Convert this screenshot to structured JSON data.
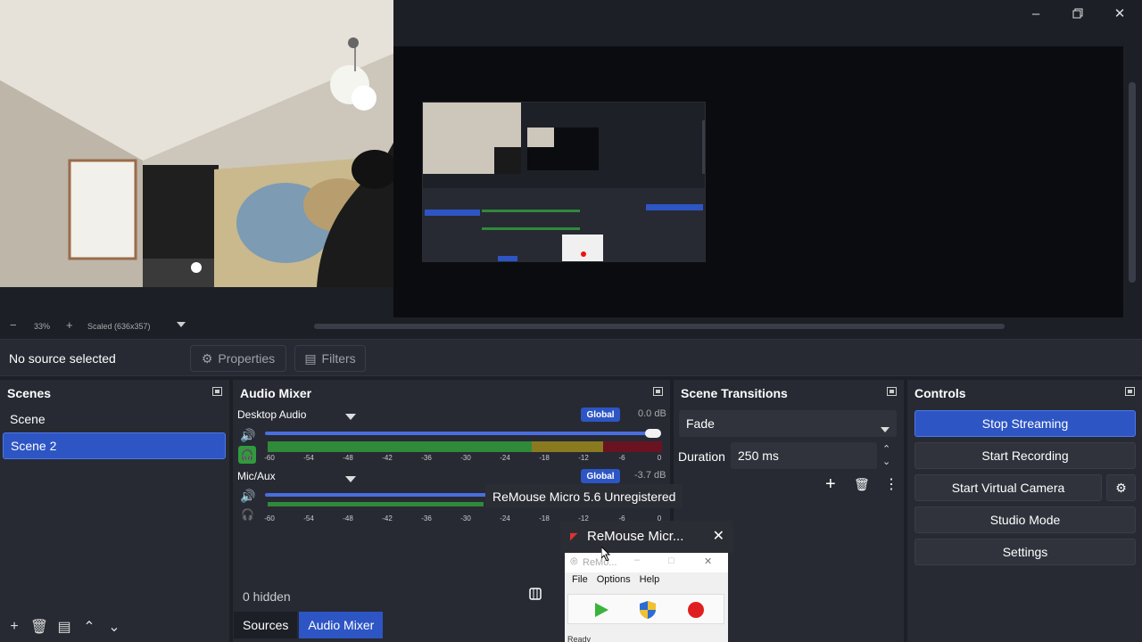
{
  "zoom": {
    "minus": "−",
    "level": "33%",
    "plus": "+",
    "scale": "Scaled (636x357)"
  },
  "context": {
    "no_source": "No source selected",
    "properties": "Properties",
    "filters": "Filters"
  },
  "scenes": {
    "title": "Scenes",
    "items": [
      "Scene",
      "Scene 2"
    ]
  },
  "mixer": {
    "title": "Audio Mixer",
    "channels": [
      {
        "name": "Desktop Audio",
        "badge": "Global",
        "db": "0.0 dB"
      },
      {
        "name": "Mic/Aux",
        "badge": "Global",
        "db": "-3.7 dB"
      }
    ],
    "ticks": [
      "-60",
      "-54",
      "-48",
      "-42",
      "-36",
      "-30",
      "-24",
      "-18",
      "-12",
      "-6",
      "0"
    ]
  },
  "sources_bar": {
    "hidden": "0 hidden"
  },
  "tabs": {
    "sources": "Sources",
    "audio_mixer": "Audio Mixer"
  },
  "transitions": {
    "title": "Scene Transitions",
    "selected": "Fade",
    "duration_label": "Duration",
    "duration_value": "250 ms"
  },
  "controls": {
    "title": "Controls",
    "stop_streaming": "Stop Streaming",
    "start_recording": "Start Recording",
    "start_virtual_camera": "Start Virtual Camera",
    "studio_mode": "Studio Mode",
    "settings": "Settings"
  },
  "tooltip": "ReMouse Micro 5.6 Unregistered",
  "remouse": {
    "taskbar_title": "ReMouse Micr...",
    "window_title": "ReMo...",
    "menu": [
      "File",
      "Options",
      "Help"
    ],
    "status": "Ready"
  },
  "colors": {
    "accent": "#2d55c4",
    "panel": "#272a33",
    "background": "#1d1f26"
  }
}
